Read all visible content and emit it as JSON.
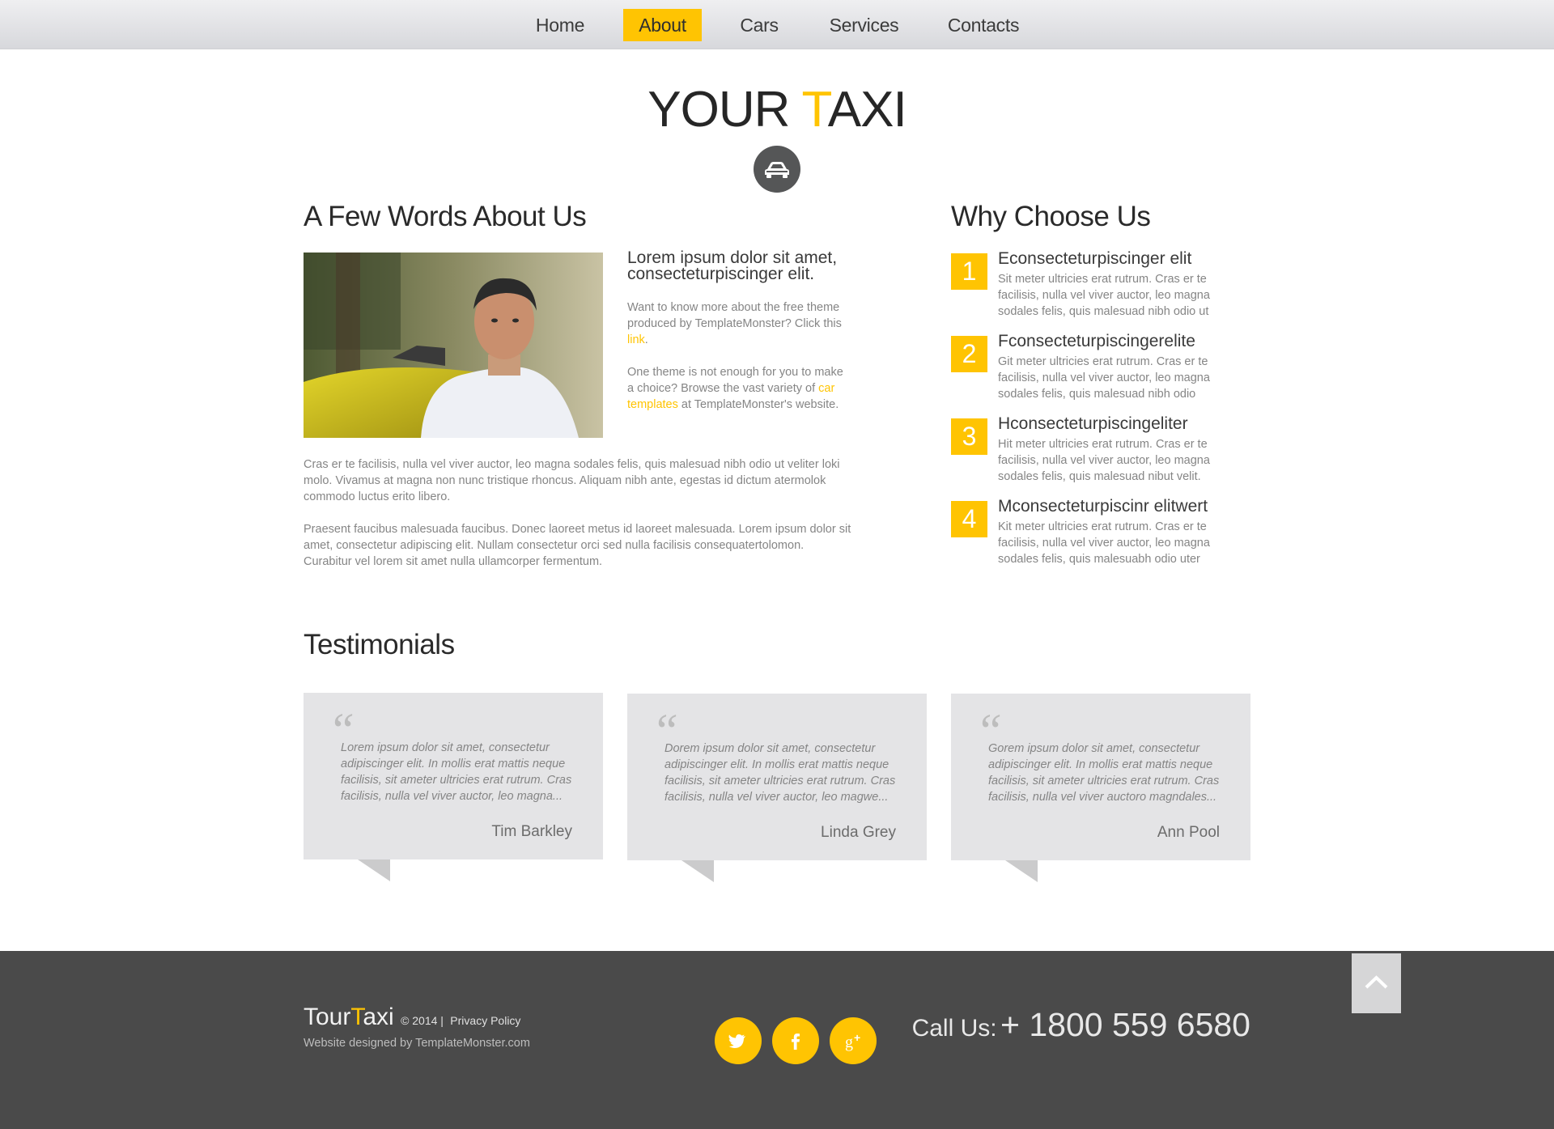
{
  "colors": {
    "accent": "#ffc402",
    "footer_bg": "#4a4a4a",
    "card_bg": "#e4e4e6"
  },
  "nav": {
    "items": [
      {
        "label": "Home"
      },
      {
        "label": "About"
      },
      {
        "label": "Cars"
      },
      {
        "label": "Services"
      },
      {
        "label": "Contacts"
      }
    ],
    "active": "About"
  },
  "logo": {
    "part1": "YOUR ",
    "accent": "T",
    "part2": "AXI",
    "badge_icon": "car-icon"
  },
  "about": {
    "heading": "A Few Words About Us",
    "lead": "Lorem ipsum dolor sit amet, consecteturpiscinger elit.",
    "p1_before": "Want to know more about the free theme produced by TemplateMonster? Click this ",
    "p1_link": "link",
    "p1_after": ".",
    "p2_before": "One theme is not enough for you to make a choice? Browse the vast variety of ",
    "p2_link": "car templates",
    "p2_after": " at TemplateMonster's website.",
    "p3": "Cras er te facilisis, nulla vel viver auctor, leo magna sodales felis, quis malesuad nibh odio ut veliter loki molo. Vivamus at magna non nunc tristique rhoncus. Aliquam nibh ante, egestas id dictum atermolok commodo luctus erito libero.",
    "p4": "Praesent faucibus malesuada faucibus. Donec laoreet metus id laoreet malesuada. Lorem ipsum dolor sit amet, consectetur adipiscing elit. Nullam consectetur orci sed nulla facilisis consequatertolomon. Curabitur vel lorem sit amet nulla ullamcorper fermentum."
  },
  "why": {
    "heading": "Why Choose Us",
    "items": [
      {
        "num": "1",
        "title": "Econsecteturpiscinger elit",
        "text": "Sit meter ultricies erat rutrum. Cras er te facilisis, nulla vel viver auctor, leo magna sodales felis, quis malesuad nibh odio ut"
      },
      {
        "num": "2",
        "title": "Fconsecteturpiscingerelite",
        "text": "Git meter ultricies erat rutrum. Cras er te facilisis, nulla vel viver auctor, leo magna sodales felis, quis malesuad nibh odio"
      },
      {
        "num": "3",
        "title": "Hconsecteturpiscingeliter",
        "text": "Hit meter ultricies erat rutrum. Cras er te facilisis, nulla vel viver auctor, leo magna sodales felis, quis malesuad nibut velit."
      },
      {
        "num": "4",
        "title": "Mconsecteturpiscinr elitwert",
        "text": "Kit meter ultricies erat rutrum. Cras er te facilisis, nulla vel viver auctor, leo magna sodales felis, quis malesuabh odio uter"
      }
    ]
  },
  "testimonials": {
    "heading": "Testimonials",
    "items": [
      {
        "text": "Lorem ipsum dolor sit amet, consectetur adipiscinger elit. In mollis erat mattis neque facilisis, sit ameter ultricies erat rutrum. Cras facilisis, nulla vel viver auctor, leo magna...",
        "name": "Tim Barkley"
      },
      {
        "text": "Dorem ipsum dolor sit amet, consectetur adipiscinger elit. In mollis erat mattis neque facilisis, sit ameter ultricies erat rutrum. Cras facilisis, nulla vel viver auctor, leo magwe...",
        "name": "Linda Grey"
      },
      {
        "text": "Gorem ipsum dolor sit amet, consectetur adipiscinger elit. In mollis erat mattis neque facilisis, sit ameter ultricies erat rutrum. Cras facilisis, nulla vel viver auctoro magndales...",
        "name": "Ann Pool"
      }
    ]
  },
  "footer": {
    "brand_part1": "Tour",
    "brand_accent": "T",
    "brand_part2": "axi",
    "copyright": "© 2014 |",
    "privacy": "Privacy Policy",
    "designed": "Website designed by TemplateMonster.com",
    "social": [
      "twitter-icon",
      "facebook-icon",
      "google-plus-icon"
    ],
    "call_label": "Call Us:",
    "phone": "+ 1800 559 6580"
  }
}
